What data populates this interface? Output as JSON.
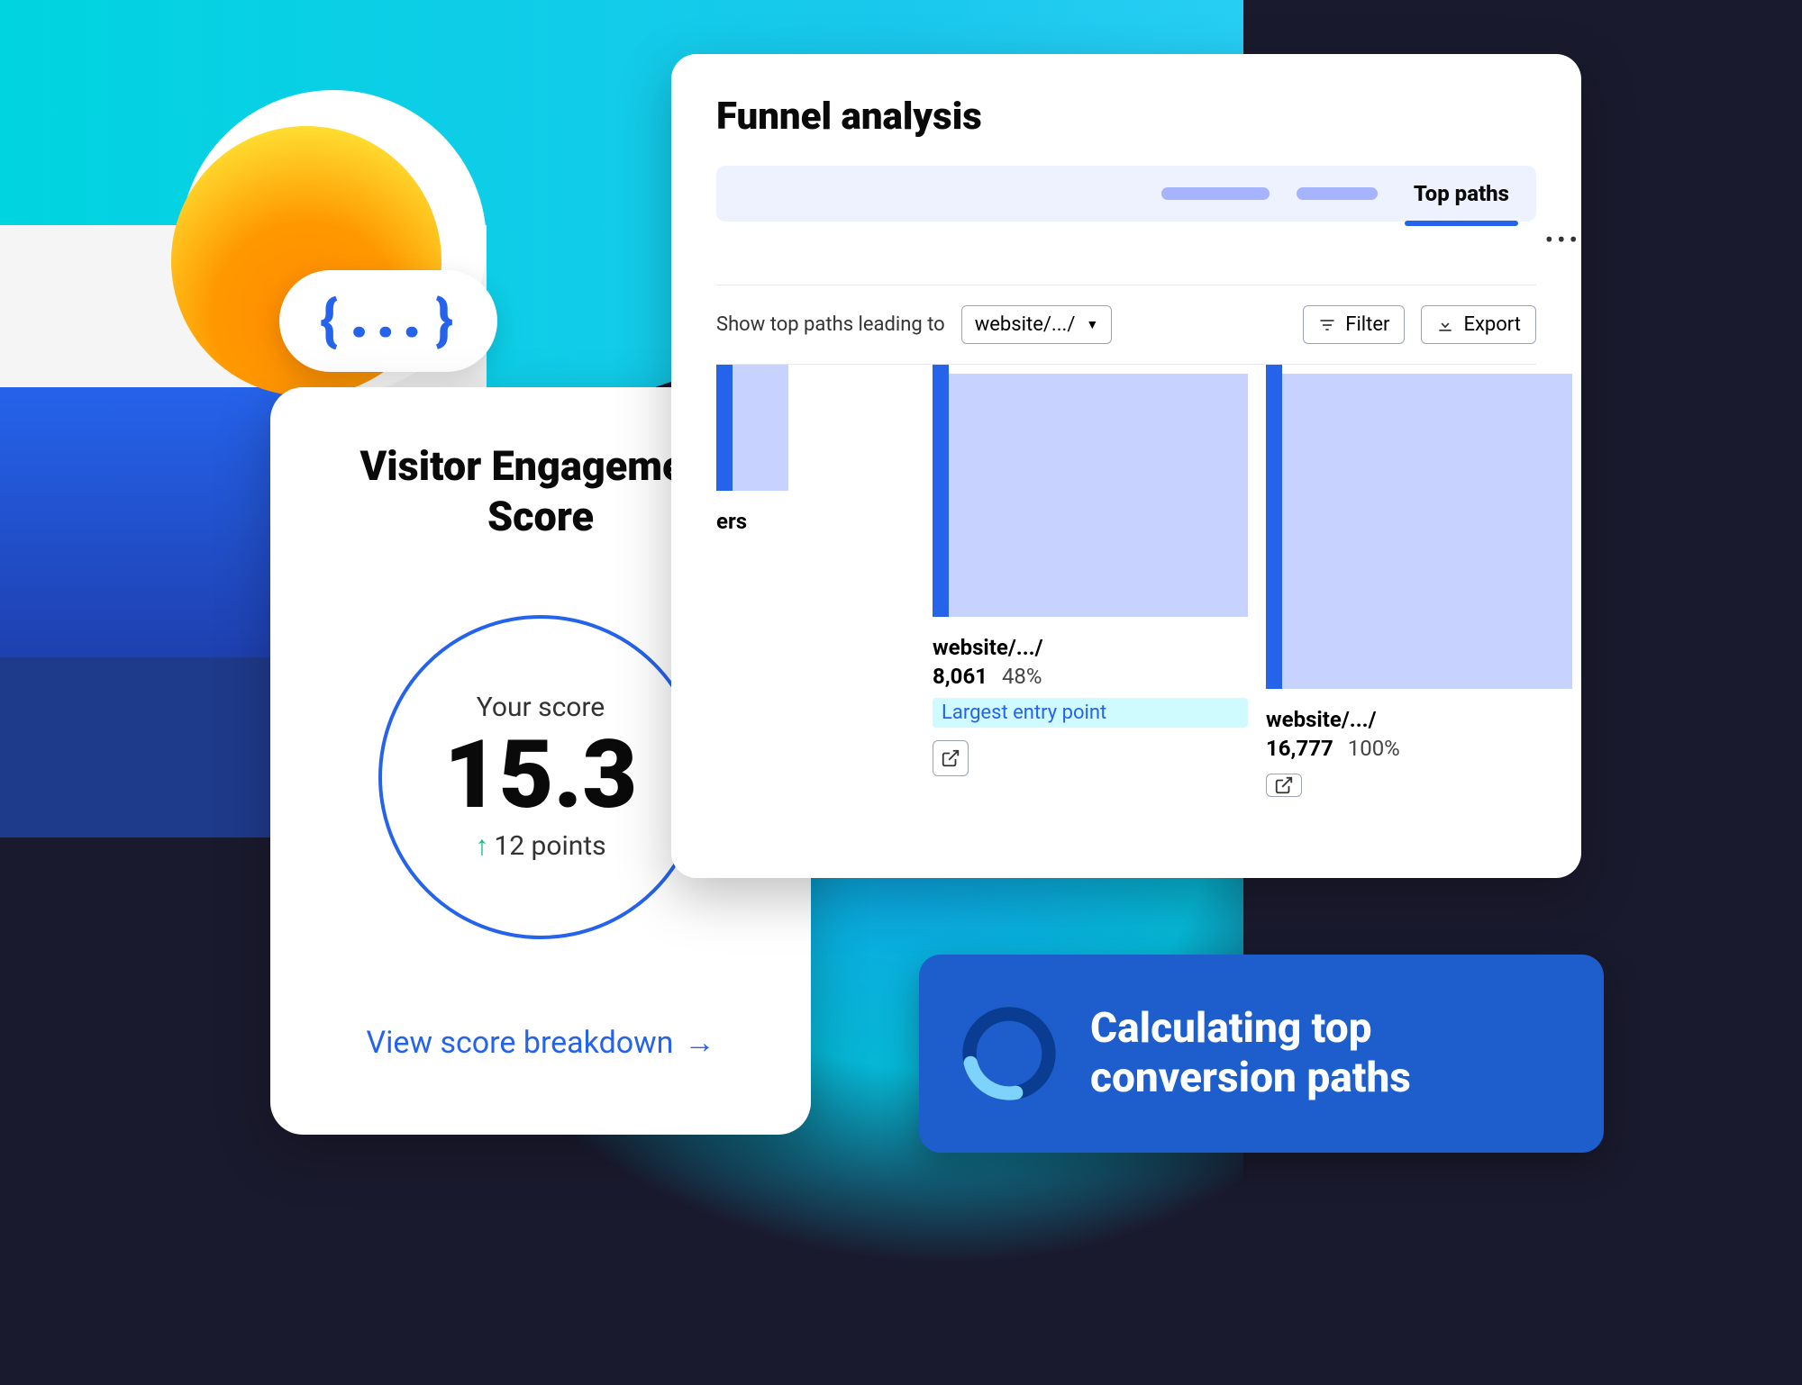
{
  "code_pill": "{ . . . }",
  "score_card": {
    "title": "Visitor Engagement Score",
    "label": "Your score",
    "value": "15.3",
    "delta": "12 points",
    "link": "View score breakdown"
  },
  "funnel": {
    "title": "Funnel analysis",
    "active_tab": "Top paths",
    "filter_label": "Show top paths leading to",
    "dropdown_value": "website/.../",
    "filter_btn": "Filter",
    "export_btn": "Export",
    "col1_partial_label": "ers",
    "col2": {
      "path": "website/.../",
      "count": "8,061",
      "pct": "48%",
      "badge": "Largest entry point"
    },
    "col3": {
      "path": "website/.../",
      "count": "16,777",
      "pct": "100%"
    }
  },
  "calc_banner": "Calculating top conversion paths"
}
